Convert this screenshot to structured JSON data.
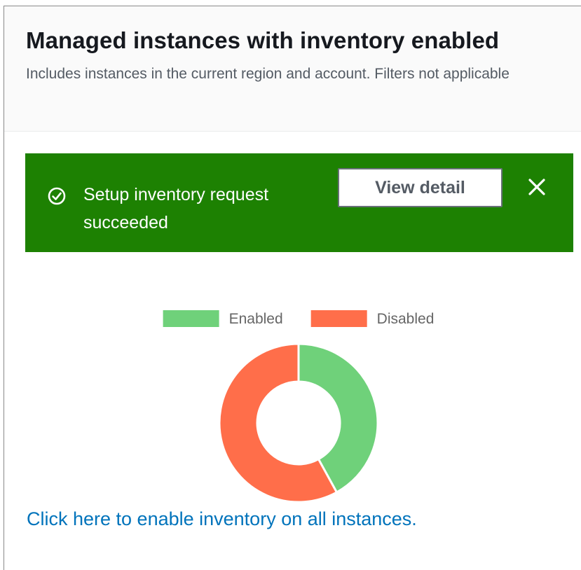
{
  "header": {
    "title": "Managed instances with inventory enabled",
    "subtitle": "Includes instances in the current region and account. Filters not applicable"
  },
  "flash": {
    "icon": "check-circle-icon",
    "message": "Setup inventory request succeeded",
    "action_label": "View detail",
    "dismiss_icon": "close-icon",
    "color": "#1d8102"
  },
  "chart_data": {
    "type": "pie",
    "style": "doughnut",
    "legend_position": "top",
    "categories": [
      "Enabled",
      "Disabled"
    ],
    "values": [
      42,
      58
    ],
    "colors": [
      "#6fd17a",
      "#ff6e4a"
    ]
  },
  "footer": {
    "enable_link": "Click here to enable inventory on all instances."
  }
}
